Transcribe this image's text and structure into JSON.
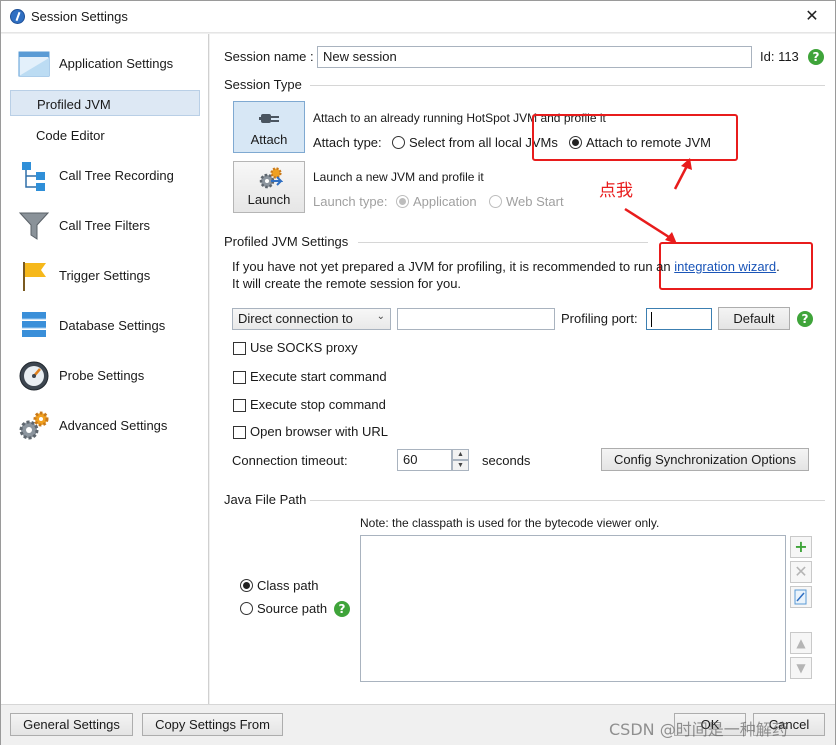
{
  "window": {
    "title": "Session Settings",
    "close_glyph": "✕"
  },
  "sidebar": {
    "items": [
      {
        "label": "Application Settings",
        "icon": "window-icon"
      },
      {
        "label": "Profiled JVM",
        "selected": true
      },
      {
        "label": "Code Editor"
      },
      {
        "label": "Call Tree Recording",
        "icon": "call-tree-icon"
      },
      {
        "label": "Call Tree Filters",
        "icon": "funnel-icon"
      },
      {
        "label": "Trigger Settings",
        "icon": "flag-icon"
      },
      {
        "label": "Database Settings",
        "icon": "database-icon"
      },
      {
        "label": "Probe Settings",
        "icon": "gauge-icon"
      },
      {
        "label": "Advanced Settings",
        "icon": "gears-icon"
      }
    ]
  },
  "session": {
    "name_label": "Session name :",
    "name_value": "New session",
    "id_label": "Id: 113",
    "help_glyph": "?"
  },
  "session_type": {
    "heading": "Session Type",
    "attach": {
      "button_label": "Attach",
      "description": "Attach to an already running HotSpot JVM and profile it",
      "type_label": "Attach type:",
      "options": [
        "Select from all local JVMs",
        "Attach to remote JVM"
      ],
      "selected": "Attach to remote JVM"
    },
    "launch": {
      "button_label": "Launch",
      "description": "Launch a new JVM and profile it",
      "type_label": "Launch type:",
      "options": [
        "Application",
        "Web Start"
      ],
      "selected": "Application"
    }
  },
  "annotation": {
    "text": "点我",
    "color": "#e81c1c"
  },
  "profiled_jvm": {
    "heading": "Profiled JVM Settings",
    "info_line1_prefix": "If you have not yet prepared a JVM for profiling, it is recommended to run an ",
    "info_link": "integration wizard",
    "info_line1_suffix": ".",
    "info_line2": "It will create the remote session for you.",
    "connection_select": "Direct connection to",
    "host_value": "",
    "port_label": "Profiling port:",
    "port_value": "",
    "default_button": "Default",
    "checkboxes": [
      "Use SOCKS proxy",
      "Execute start command",
      "Execute stop command",
      "Open browser with URL"
    ],
    "timeout_label": "Connection timeout:",
    "timeout_value": "60",
    "timeout_unit": "seconds",
    "sync_button": "Config Synchronization Options"
  },
  "java_file_path": {
    "heading": "Java File Path",
    "note": "Note: the classpath is used for the bytecode viewer only.",
    "options": [
      "Class path",
      "Source path"
    ],
    "selected": "Class path"
  },
  "footer": {
    "general_button": "General Settings",
    "copy_button": "Copy Settings From",
    "ok_button": "OK",
    "cancel_button": "Cancel",
    "watermark": "CSDN @时间是一种解药"
  },
  "colors": {
    "accent": "#2f6fc2",
    "highlight": "#e81c1c",
    "selection": "#dde8f4",
    "help": "#3fa43a"
  }
}
